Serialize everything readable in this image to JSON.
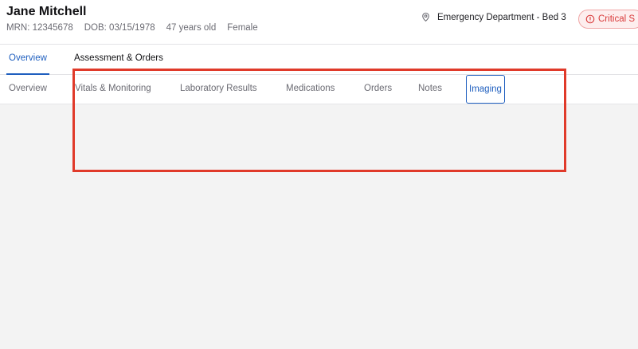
{
  "patient": {
    "name": "Jane Mitchell",
    "mrn": "MRN: 12345678",
    "dob": "DOB: 03/15/1978",
    "age": "47 years old",
    "sex": "Female"
  },
  "location": {
    "icon": "map-pin-icon",
    "label": "Emergency Department - Bed 3"
  },
  "status": {
    "icon": "alert-circle-icon",
    "label": "Critical S",
    "color": "#d93a3a"
  },
  "primary_tabs": [
    {
      "label": "Overview",
      "active": true
    },
    {
      "label": "Assessment & Orders",
      "active": false
    }
  ],
  "secondary_tabs": [
    {
      "label": "Overview",
      "active": false
    },
    {
      "label": "Vitals & Monitoring",
      "active": false
    },
    {
      "label": "Laboratory Results",
      "active": false
    },
    {
      "label": "Medications",
      "active": false
    },
    {
      "label": "Orders",
      "active": false
    },
    {
      "label": "Notes",
      "active": false
    },
    {
      "label": "Imaging",
      "active": true
    }
  ],
  "colors": {
    "accent": "#1f5fbf",
    "highlight": "#e03a2a",
    "background": "#f3f3f3"
  }
}
